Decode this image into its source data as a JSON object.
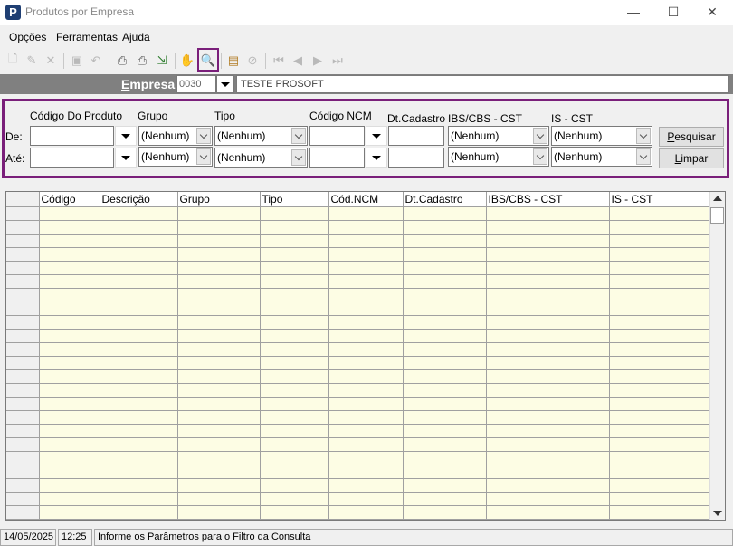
{
  "window": {
    "title": "Produtos por Empresa",
    "app_icon_letter": "P"
  },
  "menu": {
    "items": [
      "Opções",
      "Ferramentas",
      "Ajuda"
    ]
  },
  "toolbar": {
    "icons": [
      "new-icon",
      "edit-icon",
      "delete-icon",
      "save-icon",
      "undo-icon",
      "print-icon",
      "print-preview-icon",
      "export-icon",
      "hand-icon",
      "search-icon",
      "properties-icon",
      "cancel-icon",
      "first-icon",
      "prev-icon",
      "next-icon",
      "last-icon"
    ]
  },
  "empresa": {
    "label": "Empresa",
    "code": "0030",
    "name": "TESTE PROSOFT"
  },
  "filter": {
    "headers": {
      "codigo": "Código Do Produto",
      "grupo": "Grupo",
      "tipo": "Tipo",
      "ncm": "Código NCM",
      "dtcadastro": "Dt.Cadastro",
      "ibs": "IBS/CBS - CST",
      "is": "IS - CST"
    },
    "row_de": "De:",
    "row_ate": "Até:",
    "combo_value": "(Nenhum)",
    "btn_pesquisar": "Pesquisar",
    "btn_limpar": "Limpar"
  },
  "grid": {
    "columns": [
      "Código",
      "Descrição",
      "Grupo",
      "Tipo",
      "Cód.NCM",
      "Dt.Cadastro",
      "IBS/CBS - CST",
      "IS - CST"
    ]
  },
  "status": {
    "date": "14/05/2025",
    "time": "12:25",
    "message": "Informe os Parâmetros para o Filtro da Consulta"
  }
}
